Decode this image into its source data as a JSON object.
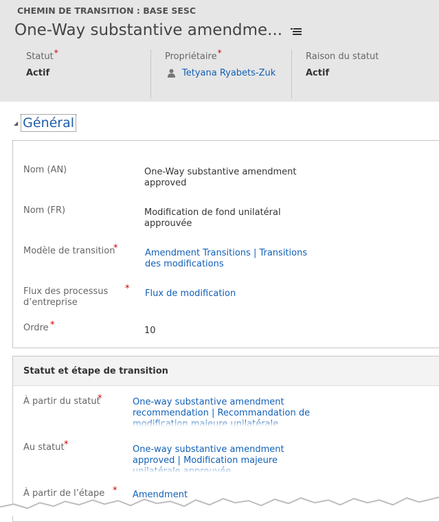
{
  "header": {
    "entity_type": "CHEMIN DE TRANSITION : BASE SESC",
    "record_title": "One-Way substantive amendme...",
    "title_menu_icon": "list-menu-icon",
    "fields": [
      {
        "label": "Statut",
        "required": "*",
        "value": "Actif"
      },
      {
        "label": "Propriétaire",
        "required": "*",
        "value": "Tetyana Ryabets-Zuk",
        "icon": "user-icon"
      },
      {
        "label": "Raison du statut",
        "value": "Actif"
      }
    ]
  },
  "general": {
    "collapse_icon": "triangle-down-icon",
    "title": "Général",
    "fields": {
      "nom_an": {
        "label": "Nom (AN)",
        "value_line1": "One-Way substantive amendment",
        "value_line2": "approved"
      },
      "nom_fr": {
        "label": "Nom (FR)",
        "value_line1": "Modification de fond unilatéral",
        "value_line2": "approuvée"
      },
      "modele": {
        "label": "Modèle de transition",
        "required": "*",
        "value_line1": "Amendment Transitions | Transitions",
        "value_line2": "des modifications"
      },
      "flux": {
        "label_line1": "Flux des processus",
        "label_line2": "d’entreprise",
        "required": "*",
        "value": "Flux de modification"
      },
      "ordre": {
        "label": "Ordre",
        "required": "*",
        "value": "10"
      }
    }
  },
  "statut_section": {
    "title": "Statut et étape de transition",
    "fields": {
      "a_partir_statut": {
        "label": "À partir du statut",
        "required": "*",
        "value_line1": "One-way substantive amendment",
        "value_line2": "recommendation | Recommandation de",
        "value_line3": "modification majeure unilatérale"
      },
      "au_statut": {
        "label": "Au statut",
        "required": "*",
        "value_line1": "One-way substantive amendment",
        "value_line2": "approved | Modification majeure",
        "value_line3": "unilatérale approuvée"
      },
      "a_partir_etape": {
        "label": "À partir de l’étape",
        "required": "*",
        "value": "Amendment"
      }
    }
  },
  "colors": {
    "header_bg": "#e6e6e6",
    "link": "#1160b7",
    "required": "#cc0000"
  }
}
